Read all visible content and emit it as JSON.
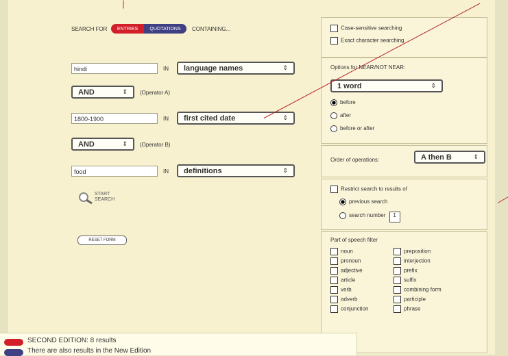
{
  "search_bar": {
    "search_for_label": "SEARCH FOR",
    "tab_entries": "ENTRIES",
    "tab_quotations": "QUOTATIONS",
    "containing_label": "CONTAINING..."
  },
  "rows": [
    {
      "input_value": "hindi",
      "is_label": "IN",
      "select_value": "language names"
    },
    {
      "operator_value": "AND",
      "operator_label": "(Operator A)"
    },
    {
      "input_value": "1800-1900",
      "is_label": "IN",
      "select_value": "first cited date"
    },
    {
      "operator_value": "AND",
      "operator_label": "(Operator B)"
    },
    {
      "input_value": "food",
      "is_label": "IN",
      "select_value": "definitions"
    }
  ],
  "actions": {
    "start_search_line1": "START",
    "start_search_line2": "SEARCH",
    "reset_form": "RESET FORM"
  },
  "options": {
    "case_sensitive": "Case-sensitive searching",
    "exact_character": "Exact character searching",
    "near_title": "Options for NEAR/NOT NEAR:",
    "near_select": "1 word",
    "before": "before",
    "after": "after",
    "before_or_after": "before or after",
    "order_label": "Order of operations:",
    "order_select": "A then B",
    "restrict": "Restrict search to results of",
    "previous_search": "previous search",
    "search_number": "search number",
    "search_number_value": "1",
    "pos_title": "Part of speech filter",
    "pos_left": [
      "noun",
      "pronoun",
      "adjective",
      "article",
      "verb",
      "adverb",
      "conjunction"
    ],
    "pos_right": [
      "preposition",
      "interjection",
      "prefix",
      "suffix",
      "combining form",
      "participle",
      "phrase"
    ]
  },
  "results": {
    "line1": "SECOND EDITION: 8 results",
    "line2": "There are also results in the New Edition"
  },
  "colors": {
    "accent_red": "#d21f2a",
    "accent_blue": "#3f3f84",
    "panel_bg": "#f7f1cf",
    "annotation_line": "#b4262c"
  }
}
